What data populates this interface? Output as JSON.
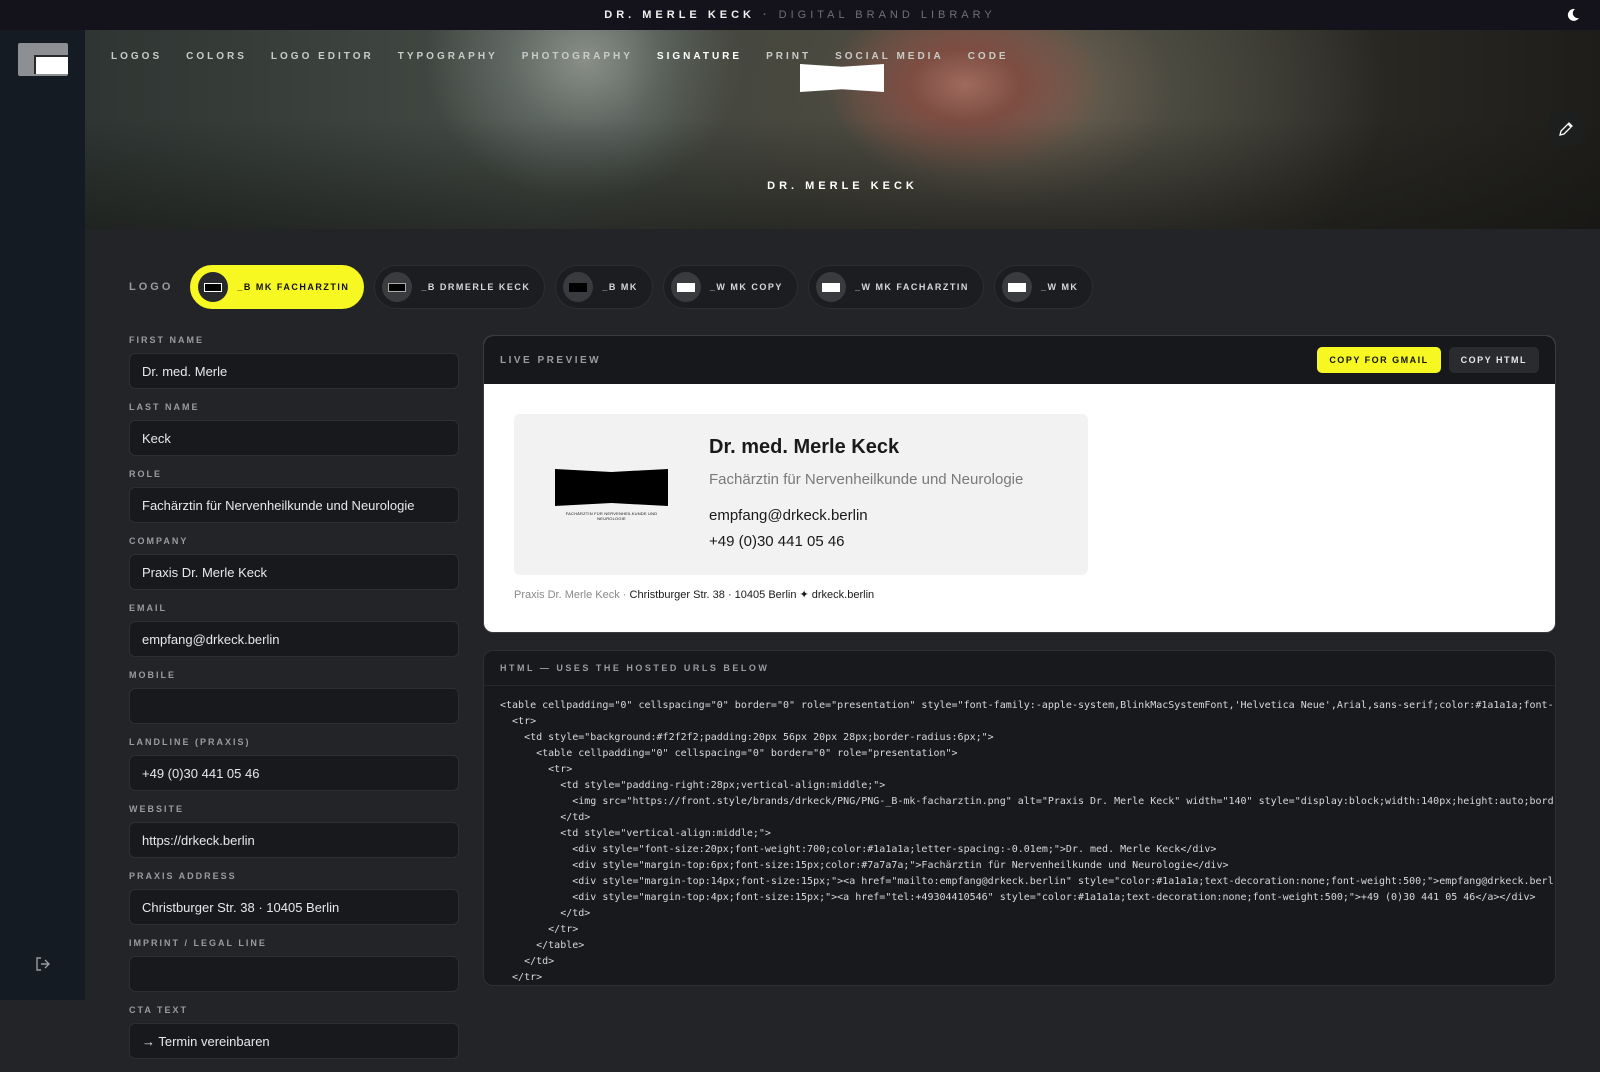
{
  "topbar": {
    "brand": "DR. MERLE KECK",
    "separator": "·",
    "subtitle": "DIGITAL BRAND LIBRARY"
  },
  "nav": [
    "LOGOS",
    "COLORS",
    "LOGO EDITOR",
    "TYPOGRAPHY",
    "PHOTOGRAPHY",
    "SIGNATURE",
    "PRINT",
    "SOCIAL MEDIA",
    "CODE"
  ],
  "nav_active": "SIGNATURE",
  "hero": {
    "name": "DR. MERLE KECK"
  },
  "logo_picker": {
    "label": "LOGO",
    "options": [
      "_B MK FACHARZTIN",
      "_B DRMERLE KECK",
      "_B MK",
      "_W MK COPY",
      "_W MK FACHARZTIN",
      "_W MK"
    ],
    "selected": "_B MK FACHARZTIN"
  },
  "form": {
    "first_name": {
      "label": "FIRST NAME",
      "value": "Dr. med. Merle"
    },
    "last_name": {
      "label": "LAST NAME",
      "value": "Keck"
    },
    "role": {
      "label": "ROLE",
      "value": "Fachärztin für Nervenheilkunde und Neurologie"
    },
    "company": {
      "label": "COMPANY",
      "value": "Praxis Dr. Merle Keck"
    },
    "email": {
      "label": "EMAIL",
      "value": "empfang@drkeck.berlin"
    },
    "mobile": {
      "label": "MOBILE",
      "value": ""
    },
    "landline": {
      "label": "LANDLINE (PRAXIS)",
      "value": "+49 (0)30 441 05 46"
    },
    "website": {
      "label": "WEBSITE",
      "value": "https://drkeck.berlin"
    },
    "address": {
      "label": "PRAXIS ADDRESS",
      "value": "Christburger Str. 38 · 10405 Berlin"
    },
    "imprint": {
      "label": "IMPRINT / LEGAL LINE",
      "value": ""
    },
    "cta": {
      "label": "CTA TEXT",
      "value": "→ Termin vereinbaren"
    }
  },
  "preview": {
    "title": "LIVE PREVIEW",
    "copy_gmail": "COPY FOR GMAIL",
    "copy_html": "COPY HTML",
    "logo_caption": "FACHÄRZTIN FÜR NERVENHEILKUNDE UND NEUROLOGIE",
    "name": "Dr. med. Merle Keck",
    "role": "Fachärztin für Nervenheilkunde und Neurologie",
    "email": "empfang@drkeck.berlin",
    "phone": "+49 (0)30 441 05 46",
    "footer_company": "Praxis Dr. Merle Keck ·",
    "footer_rest": "Christburger Str. 38 · 10405 Berlin ✦ drkeck.berlin"
  },
  "code": {
    "title": "HTML — USES THE HOSTED URLS BELOW",
    "lines": [
      "<table cellpadding=\"0\" cellspacing=\"0\" border=\"0\" role=\"presentation\" style=\"font-family:-apple-system,BlinkMacSystemFont,'Helvetica Neue',Arial,sans-serif;color:#1a1a1a;font-",
      "  <tr>",
      "    <td style=\"background:#f2f2f2;padding:20px 56px 20px 28px;border-radius:6px;\">",
      "      <table cellpadding=\"0\" cellspacing=\"0\" border=\"0\" role=\"presentation\">",
      "        <tr>",
      "          <td style=\"padding-right:28px;vertical-align:middle;\">",
      "            <img src=\"https://front.style/brands/drkeck/PNG/PNG-_B-mk-facharztin.png\" alt=\"Praxis Dr. Merle Keck\" width=\"140\" style=\"display:block;width:140px;height:auto;bord",
      "          </td>",
      "          <td style=\"vertical-align:middle;\">",
      "            <div style=\"font-size:20px;font-weight:700;color:#1a1a1a;letter-spacing:-0.01em;\">Dr. med. Merle Keck</div>",
      "            <div style=\"margin-top:6px;font-size:15px;color:#7a7a7a;\">Fachärztin für Nervenheilkunde und Neurologie</div>",
      "            <div style=\"margin-top:14px;font-size:15px;\"><a href=\"mailto:empfang@drkeck.berlin\" style=\"color:#1a1a1a;text-decoration:none;font-weight:500;\">empfang@drkeck.berl",
      "            <div style=\"margin-top:4px;font-size:15px;\"><a href=\"tel:+49304410546\" style=\"color:#1a1a1a;text-decoration:none;font-weight:500;\">+49 (0)30 441 05 46</a></div>",
      "          </td>",
      "        </tr>",
      "      </table>",
      "    </td>",
      "  </tr>"
    ]
  },
  "colors": {
    "accent": "#f7f722",
    "bg": "#232427",
    "rail": "#151b22"
  }
}
